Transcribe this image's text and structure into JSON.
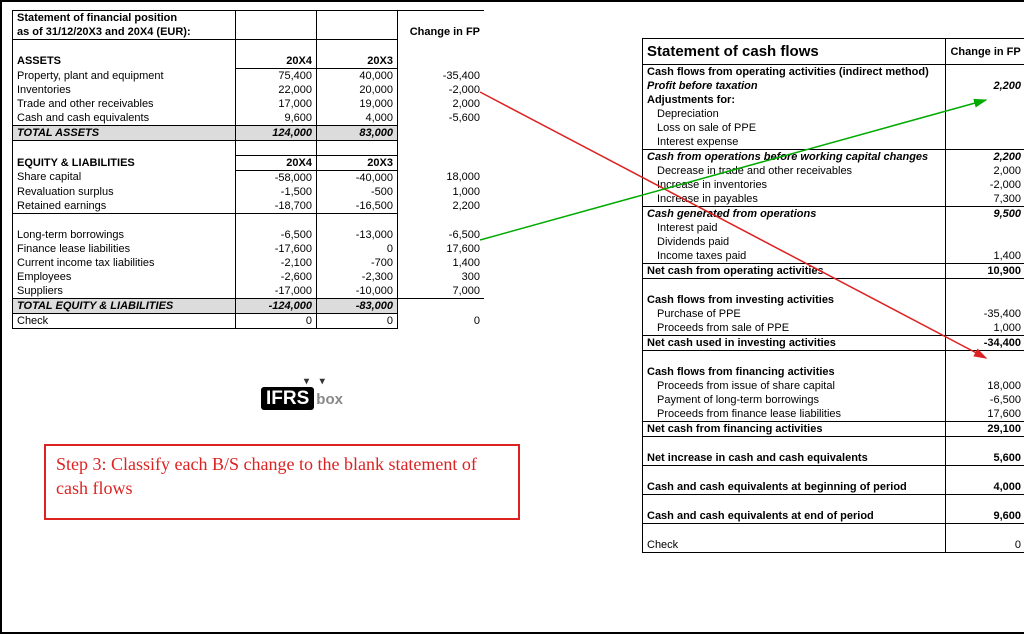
{
  "left": {
    "title1": "Statement of financial position",
    "title2": "as of 31/12/20X3 and 20X4 (EUR):",
    "chgHdr": "Change in FP",
    "assets": "ASSETS",
    "c1": "20X4",
    "c2": "20X3",
    "ppe": "Property, plant and equipment",
    "ppe1": "75,400",
    "ppe2": "40,000",
    "ppeC": "-35,400",
    "inv": "Inventories",
    "inv1": "22,000",
    "inv2": "20,000",
    "invC": "-2,000",
    "tr": "Trade and other receivables",
    "tr1": "17,000",
    "tr2": "19,000",
    "trC": "2,000",
    "ca": "Cash and cash equivalents",
    "ca1": "9,600",
    "ca2": "4,000",
    "caC": "-5,600",
    "ta": "TOTAL ASSETS",
    "ta1": "124,000",
    "ta2": "83,000",
    "eq": "EQUITY & LIABILITIES",
    "sc": "Share capital",
    "sc1": "-58,000",
    "sc2": "-40,000",
    "scC": "18,000",
    "rs": "Revaluation surplus",
    "rs1": "-1,500",
    "rs2": "-500",
    "rsC": "1,000",
    "re": "Retained earnings",
    "re1": "-18,700",
    "re2": "-16,500",
    "reC": "2,200",
    "lt": "Long-term borrowings",
    "lt1": "-6,500",
    "lt2": "-13,000",
    "ltC": "-6,500",
    "fl": "Finance lease liabilities",
    "fl1": "-17,600",
    "fl2": "0",
    "flC": "17,600",
    "ci": "Current income tax liabilities",
    "ci1": "-2,100",
    "ci2": "-700",
    "ciC": "1,400",
    "em": "Employees",
    "em1": "-2,600",
    "em2": "-2,300",
    "emC": "300",
    "su": "Suppliers",
    "su1": "-17,000",
    "su2": "-10,000",
    "suC": "7,000",
    "te": "TOTAL EQUITY & LIABILITIES",
    "te1": "-124,000",
    "te2": "-83,000",
    "chk": "Check",
    "chk1": "0",
    "chk2": "0",
    "chkC": "0"
  },
  "right": {
    "title": "Statement of cash flows",
    "chg": "Change in FP",
    "op": "Cash flows from operating activities (indirect method)",
    "pbt": "Profit before taxation",
    "pbtV": "2,200",
    "adj": "Adjustments for:",
    "dep": "Depreciation",
    "los": "Loss on sale of PPE",
    "ie": "Interest expense",
    "cfo": "Cash from operations before working capital changes",
    "cfoV": "2,200",
    "dtr": "Decrease in trade and other receivables",
    "dtrV": "2,000",
    "iin": "Increase in inventories",
    "iinV": "-2,000",
    "ipa": "Increase in payables",
    "ipaV": "7,300",
    "cgo": "Cash generated from operations",
    "cgoV": "9,500",
    "ip": "Interest paid",
    "dp": "Dividends paid",
    "itp": "Income taxes paid",
    "itpV": "1,400",
    "ncoa": "Net cash from operating activities",
    "ncoaV": "10,900",
    "inv": "Cash flows from investing activities",
    "pur": "Purchase of PPE",
    "purV": "-35,400",
    "pro": "Proceeds from sale of PPE",
    "proV": "1,000",
    "ncia": "Net cash used in investing activities",
    "nciaV": "-34,400",
    "fin": "Cash flows from financing activities",
    "psc": "Proceeds from issue of share capital",
    "pscV": "18,000",
    "plt": "Payment of long-term borrowings",
    "pltV": "-6,500",
    "pfl": "Proceeds from finance lease liabilities",
    "pflV": "17,600",
    "ncfa": "Net cash from financing activities",
    "ncfaV": "29,100",
    "nic": "Net increase in cash and cash equivalents",
    "nicV": "5,600",
    "beg": "Cash and cash equivalents at beginning of period",
    "begV": "4,000",
    "end": "Cash and cash equivalents at end of period",
    "endV": "9,600",
    "chk": "Check",
    "chkV": "0"
  },
  "step": "Step 3: Classify each B/S change to the blank statement of cash flows",
  "logo1": "IFRS",
  "logo2": "box"
}
